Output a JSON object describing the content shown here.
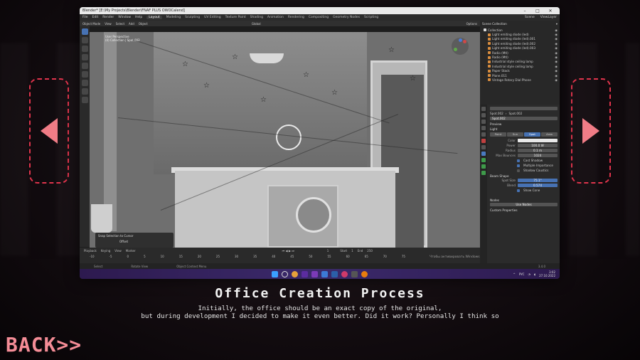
{
  "slide": {
    "title": "Office Creation Process",
    "text_line1": "Initially, the office should be an exact copy of the original,",
    "text_line2": "but during development I decided to make it even better. Did it work? Personally I think so"
  },
  "nav": {
    "back_label": "BACK>>",
    "prev_icon": "triangle-left-icon",
    "next_icon": "triangle-right-icon"
  },
  "colors": {
    "accent_red": "#e0344c",
    "accent_pink": "#f07c86",
    "blender_blue": "#4772b3"
  },
  "screenshot": {
    "window_title": "Blender* [E:\\My Projects\\Blender\\FNAF PLUS OWOCalend]",
    "menu": [
      "File",
      "Edit",
      "Render",
      "Window",
      "Help"
    ],
    "workspaces": [
      "Layout",
      "Modeling",
      "Sculpting",
      "UV Editing",
      "Texture Paint",
      "Shading",
      "Animation",
      "Rendering",
      "Compositing",
      "Geometry Nodes",
      "Scripting"
    ],
    "active_workspace": "Layout",
    "scene_label": "Scene",
    "view_layer_label": "ViewLayer",
    "viewport_header": {
      "mode": "Object Mode",
      "items": [
        "View",
        "Select",
        "Add",
        "Object"
      ],
      "transform": "Global",
      "options": "Options"
    },
    "viewport_overlay": {
      "line1": "User Perspective",
      "line2": "(0) Collection | Spot.002"
    },
    "operator_panel": {
      "title": "Snap Selection to Cursor",
      "option": "Offset"
    },
    "timeline": {
      "items": [
        "Playback",
        "Keying",
        "View",
        "Marker"
      ],
      "frame": "1",
      "start_label": "Start",
      "start": "1",
      "end_label": "End",
      "end": "250",
      "ticks": [
        "-10",
        "-5",
        "0",
        "5",
        "10",
        "15",
        "20",
        "25",
        "30",
        "35",
        "40",
        "45",
        "50",
        "55",
        "60",
        "65",
        "70",
        "75",
        "80",
        "85",
        "90",
        "95"
      ]
    },
    "windows_activation": "Чтобы активировать Windows, перейдите в раздел \"Параметры\"",
    "status": {
      "select": "Select",
      "rotate": "Rotate View",
      "context": "Object Context Menu",
      "version": "3.4.0"
    },
    "outliner": {
      "title": "Scene Collection",
      "rows": [
        {
          "label": "Collection",
          "selected": false
        },
        {
          "label": "Light emiting diode (led)",
          "selected": false
        },
        {
          "label": "Light emiting diode (led).001",
          "selected": false
        },
        {
          "label": "Light emiting diode (led).002",
          "selected": false
        },
        {
          "label": "Light emiting diode (led).003",
          "selected": false
        },
        {
          "label": "Radio (Mtl)",
          "selected": false
        },
        {
          "label": "Radio (Mtl)",
          "selected": false
        },
        {
          "label": "Industrial style ceiling lamp",
          "selected": false
        },
        {
          "label": "Industrial style ceiling lamp",
          "selected": false
        },
        {
          "label": "Paper Stack",
          "selected": false
        },
        {
          "label": "Plane.011",
          "selected": false
        },
        {
          "label": "Vintage Rotary Dial Phone",
          "selected": false
        }
      ]
    },
    "properties": {
      "search_placeholder": "",
      "breadcrumb": [
        "Spot.002",
        "Spot.002"
      ],
      "data_name": "Spot.002",
      "sections": {
        "preview": "Preview",
        "light": "Light",
        "beam_shape": "Beam Shape",
        "nodes": "Nodes",
        "custom": "Custom Properties"
      },
      "light_types": [
        "Point",
        "Sun",
        "Spot",
        "Area"
      ],
      "active_light_type": "Spot",
      "fields": [
        {
          "label": "Color",
          "value": "",
          "style": "white"
        },
        {
          "label": "Power",
          "value": "100.0 W",
          "style": "normal"
        },
        {
          "label": "Radius",
          "value": "0.1 m",
          "style": "normal"
        },
        {
          "label": "Max Bounces",
          "value": "1024",
          "style": "normal"
        }
      ],
      "checks": [
        {
          "label": "Cast Shadow",
          "on": true
        },
        {
          "label": "Multiple Importance",
          "on": true
        },
        {
          "label": "Shadow Caustics",
          "on": false
        }
      ],
      "beam_fields": [
        {
          "label": "Spot Size",
          "value": "75.1°"
        },
        {
          "label": "Blend",
          "value": "0.574"
        }
      ],
      "show_cone": "Show Cone",
      "use_nodes": "Use Nodes"
    },
    "tray": {
      "lang": "РУС",
      "time": "3:02",
      "date": "27.10.2022"
    }
  }
}
